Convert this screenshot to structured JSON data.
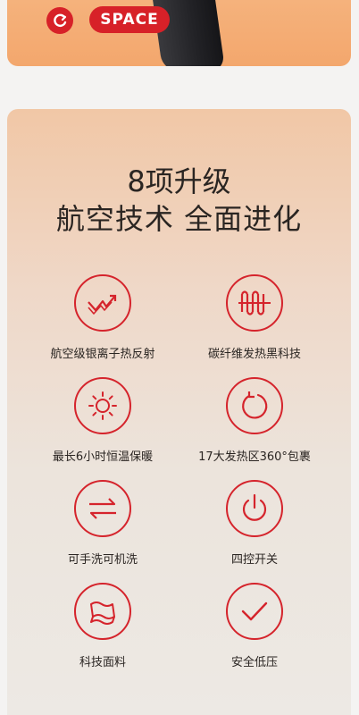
{
  "banner": {
    "badge_text": "SPACE",
    "brand_color": "#d72128"
  },
  "card": {
    "title_line1": "8项升级",
    "title_line2": "航空技术 全面进化",
    "accent_color": "#d5242c"
  },
  "features": [
    {
      "label": "航空级银离子热反射",
      "icon": "trend-arrows-icon"
    },
    {
      "label": "碳纤维发热黑科技",
      "icon": "heating-coil-icon"
    },
    {
      "label": "最长6小时恒温保暖",
      "icon": "sun-icon"
    },
    {
      "label": "17大发热区360°包裹",
      "icon": "rotate-arrow-icon"
    },
    {
      "label": "可手洗可机洗",
      "icon": "swap-arrows-icon"
    },
    {
      "label": "四控开关",
      "icon": "power-icon"
    },
    {
      "label": "科技面料",
      "icon": "fabric-icon"
    },
    {
      "label": "安全低压",
      "icon": "check-icon"
    }
  ]
}
